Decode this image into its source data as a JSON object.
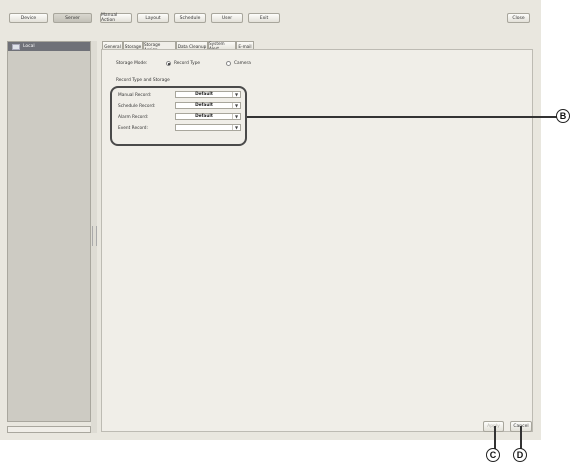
{
  "toolbar": {
    "device": "Device",
    "server": "Server",
    "manual_action": "Manual Action",
    "layout": "Layout",
    "schedule": "Schedule",
    "user": "User",
    "exit": "Exit",
    "close": "Close"
  },
  "sidebar": {
    "root_label": "Local"
  },
  "tabs": [
    "General",
    "Storage",
    "Storage Assign",
    "Data Cleanup",
    "System Alert",
    "E-mail"
  ],
  "storage_mode": {
    "label": "Storage Mode:",
    "option_record_type": "Record Type",
    "option_camera": "Camera",
    "selected": "Record Type"
  },
  "section_title": "Record Type and Storage",
  "records": [
    {
      "label": "Manual Record:",
      "value": "Default"
    },
    {
      "label": "Schedule Record:",
      "value": "Default"
    },
    {
      "label": "Alarm Record:",
      "value": "Default"
    },
    {
      "label": "Event Record:",
      "value": ""
    }
  ],
  "buttons": {
    "apply": "Apply",
    "cancel": "Cancel"
  },
  "callouts": {
    "b": "B",
    "c": "C",
    "d": "D"
  },
  "colors": {
    "accent": "#6f7178",
    "panel": "#f0eee8",
    "background": "#e9e7df"
  }
}
